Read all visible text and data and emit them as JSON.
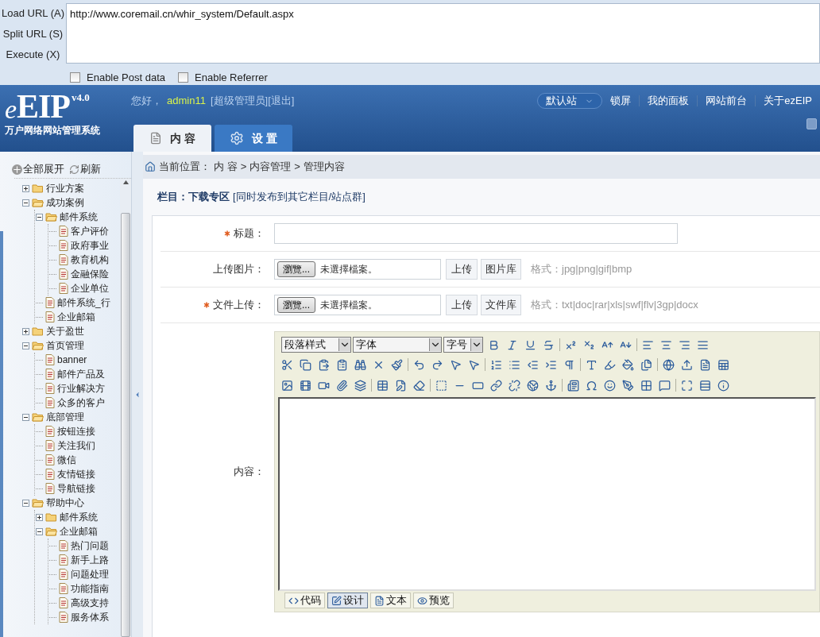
{
  "hackbar": {
    "actions": [
      "Load URL (A)",
      "Split URL (S)",
      "Execute (X)"
    ],
    "url": "http://www.coremail.cn/whir_system/Default.aspx",
    "options": [
      {
        "label": "Enable Post data",
        "checked": false
      },
      {
        "label": "Enable Referrer",
        "checked": false
      }
    ]
  },
  "header": {
    "logo_mark": "e",
    "logo": "EIP",
    "version": "v4.0",
    "logo_subtitle": "万户网络网站管理系统",
    "greeting": "您好，",
    "user": "admin11",
    "role": "[超级管理员]",
    "logout": "[退出]",
    "site_select": "默认站",
    "links": [
      "锁屏",
      "我的面板",
      "网站前台",
      "关于ezEIP"
    ],
    "tabs": [
      {
        "label": "内 容",
        "selected": true
      },
      {
        "label": "设 置",
        "selected": false
      }
    ]
  },
  "sidebar": {
    "actions": [
      "全部展开",
      "刷新"
    ],
    "tree": [
      {
        "kind": "folder",
        "label": "行业方案",
        "expanded": false
      },
      {
        "kind": "folder",
        "label": "成功案例",
        "expanded": true,
        "children": [
          {
            "kind": "folder",
            "label": "邮件系统",
            "expanded": true,
            "children": [
              {
                "kind": "page",
                "label": "客户评价"
              },
              {
                "kind": "page",
                "label": "政府事业"
              },
              {
                "kind": "page",
                "label": "教育机构"
              },
              {
                "kind": "page",
                "label": "金融保险"
              },
              {
                "kind": "page",
                "label": "企业单位"
              }
            ]
          },
          {
            "kind": "page",
            "label": "邮件系统_行"
          },
          {
            "kind": "page",
            "label": "企业邮箱"
          }
        ]
      },
      {
        "kind": "folder",
        "label": "关于盈世",
        "expanded": false
      },
      {
        "kind": "folder",
        "label": "首页管理",
        "expanded": true,
        "children": [
          {
            "kind": "page",
            "label": "banner"
          },
          {
            "kind": "page",
            "label": "邮件产品及"
          },
          {
            "kind": "page",
            "label": "行业解决方"
          },
          {
            "kind": "page",
            "label": "众多的客户"
          }
        ]
      },
      {
        "kind": "folder",
        "label": "底部管理",
        "expanded": true,
        "children": [
          {
            "kind": "page",
            "label": "按钮连接"
          },
          {
            "kind": "page",
            "label": "关注我们"
          },
          {
            "kind": "page",
            "label": "微信"
          },
          {
            "kind": "page",
            "label": "友情链接"
          },
          {
            "kind": "page",
            "label": "导航链接"
          }
        ]
      },
      {
        "kind": "folder",
        "label": "帮助中心",
        "expanded": true,
        "children": [
          {
            "kind": "folder",
            "label": "邮件系统",
            "expanded": false
          },
          {
            "kind": "folder",
            "label": "企业邮箱",
            "expanded": true,
            "children": [
              {
                "kind": "page",
                "label": "热门问题"
              },
              {
                "kind": "page",
                "label": "新手上路"
              },
              {
                "kind": "page",
                "label": "问题处理"
              },
              {
                "kind": "page",
                "label": "功能指南"
              },
              {
                "kind": "page",
                "label": "高级支持"
              },
              {
                "kind": "page",
                "label": "服务体系"
              }
            ]
          }
        ]
      }
    ]
  },
  "breadcrumb": {
    "label": "当前位置：",
    "path": [
      "内 容",
      "内容管理",
      "管理内容"
    ],
    "separator": ">"
  },
  "column": {
    "label": "栏目：",
    "name": "下载专区",
    "link": "[同时发布到其它栏目/站点群]"
  },
  "form": {
    "fields": [
      {
        "kind": "text",
        "required": true,
        "label": "标题："
      },
      {
        "kind": "file",
        "required": false,
        "label": "上传图片：",
        "browse": "瀏覽...",
        "file_status": "未選擇檔案。",
        "upload": "上传",
        "library": "图片库",
        "hint": "格式：jpg|png|gif|bmp"
      },
      {
        "kind": "file",
        "required": true,
        "label": "文件上传：",
        "browse": "瀏覽...",
        "file_status": "未選擇檔案。",
        "upload": "上传",
        "library": "文件库",
        "hint": "格式：txt|doc|rar|xls|swf|flv|3gp|docx"
      },
      {
        "kind": "editor",
        "required": false,
        "label": "内容："
      }
    ]
  },
  "editor": {
    "selects": [
      "段落样式",
      "字体",
      "字号"
    ],
    "modes": [
      {
        "label": "代码",
        "selected": false
      },
      {
        "label": "设计",
        "selected": true
      },
      {
        "label": "文本",
        "selected": false
      },
      {
        "label": "预览",
        "selected": false
      }
    ]
  }
}
